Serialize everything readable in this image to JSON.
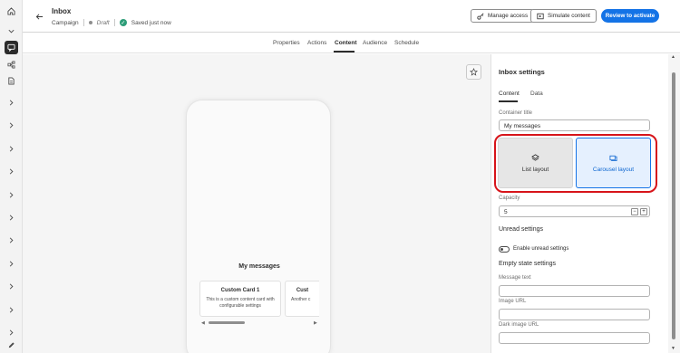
{
  "rail": {
    "items": [
      {
        "icon": "home-icon"
      },
      {
        "icon": "chevron-down-icon"
      },
      {
        "icon": "message-icon",
        "active": true
      },
      {
        "icon": "workflow-icon"
      },
      {
        "icon": "document-icon"
      },
      {
        "icon": "chevron-right-icon"
      },
      {
        "icon": "chevron-right-icon"
      },
      {
        "icon": "chevron-right-icon"
      },
      {
        "icon": "chevron-right-icon"
      },
      {
        "icon": "chevron-right-icon"
      },
      {
        "icon": "chevron-right-icon"
      },
      {
        "icon": "chevron-right-icon"
      },
      {
        "icon": "chevron-right-icon"
      },
      {
        "icon": "chevron-right-icon"
      },
      {
        "icon": "chevron-right-icon"
      },
      {
        "icon": "edit-icon"
      }
    ]
  },
  "header": {
    "title": "Inbox",
    "type": "Campaign",
    "status": "Draft",
    "saved": "Saved just now",
    "manage_access": "Manage access",
    "simulate": "Simulate content",
    "review": "Review to activate"
  },
  "tabs": [
    "Properties",
    "Actions",
    "Content",
    "Audience",
    "Schedule"
  ],
  "active_tab": "Content",
  "preview": {
    "title": "My messages",
    "cards": [
      {
        "title": "Custom Card 1",
        "text": "This is a custom content card with configurable settings"
      },
      {
        "title": "Cust",
        "text": "Another c"
      }
    ]
  },
  "panel": {
    "title": "Inbox settings",
    "tabs": [
      "Content",
      "Data"
    ],
    "container_title_label": "Container title",
    "container_title_value": "My messages",
    "list_layout": "List layout",
    "carousel_layout": "Carousel layout",
    "capacity_label": "Capacity",
    "capacity_value": "5",
    "unread_settings": "Unread settings",
    "enable_unread": "Enable unread settings",
    "empty_state": "Empty state settings",
    "message_text_label": "Message text",
    "image_url_label": "Image URL",
    "dark_image_url_label": "Dark image URL"
  },
  "colors": {
    "accent": "#1473e6",
    "highlight": "#d7141a",
    "saved": "#2d9d78"
  }
}
